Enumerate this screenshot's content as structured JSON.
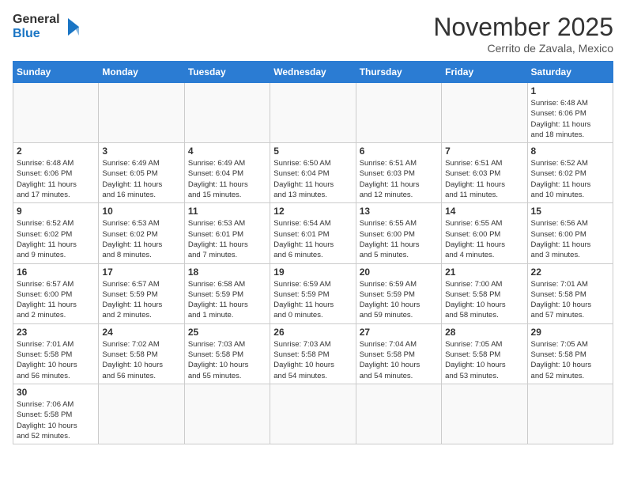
{
  "logo": {
    "line1": "General",
    "line2": "Blue"
  },
  "title": "November 2025",
  "location": "Cerrito de Zavala, Mexico",
  "days_of_week": [
    "Sunday",
    "Monday",
    "Tuesday",
    "Wednesday",
    "Thursday",
    "Friday",
    "Saturday"
  ],
  "weeks": [
    [
      {
        "day": "",
        "info": ""
      },
      {
        "day": "",
        "info": ""
      },
      {
        "day": "",
        "info": ""
      },
      {
        "day": "",
        "info": ""
      },
      {
        "day": "",
        "info": ""
      },
      {
        "day": "",
        "info": ""
      },
      {
        "day": "1",
        "info": "Sunrise: 6:48 AM\nSunset: 6:06 PM\nDaylight: 11 hours\nand 18 minutes."
      }
    ],
    [
      {
        "day": "2",
        "info": "Sunrise: 6:48 AM\nSunset: 6:06 PM\nDaylight: 11 hours\nand 17 minutes."
      },
      {
        "day": "3",
        "info": "Sunrise: 6:49 AM\nSunset: 6:05 PM\nDaylight: 11 hours\nand 16 minutes."
      },
      {
        "day": "4",
        "info": "Sunrise: 6:49 AM\nSunset: 6:04 PM\nDaylight: 11 hours\nand 15 minutes."
      },
      {
        "day": "5",
        "info": "Sunrise: 6:50 AM\nSunset: 6:04 PM\nDaylight: 11 hours\nand 13 minutes."
      },
      {
        "day": "6",
        "info": "Sunrise: 6:51 AM\nSunset: 6:03 PM\nDaylight: 11 hours\nand 12 minutes."
      },
      {
        "day": "7",
        "info": "Sunrise: 6:51 AM\nSunset: 6:03 PM\nDaylight: 11 hours\nand 11 minutes."
      },
      {
        "day": "8",
        "info": "Sunrise: 6:52 AM\nSunset: 6:02 PM\nDaylight: 11 hours\nand 10 minutes."
      }
    ],
    [
      {
        "day": "9",
        "info": "Sunrise: 6:52 AM\nSunset: 6:02 PM\nDaylight: 11 hours\nand 9 minutes."
      },
      {
        "day": "10",
        "info": "Sunrise: 6:53 AM\nSunset: 6:02 PM\nDaylight: 11 hours\nand 8 minutes."
      },
      {
        "day": "11",
        "info": "Sunrise: 6:53 AM\nSunset: 6:01 PM\nDaylight: 11 hours\nand 7 minutes."
      },
      {
        "day": "12",
        "info": "Sunrise: 6:54 AM\nSunset: 6:01 PM\nDaylight: 11 hours\nand 6 minutes."
      },
      {
        "day": "13",
        "info": "Sunrise: 6:55 AM\nSunset: 6:00 PM\nDaylight: 11 hours\nand 5 minutes."
      },
      {
        "day": "14",
        "info": "Sunrise: 6:55 AM\nSunset: 6:00 PM\nDaylight: 11 hours\nand 4 minutes."
      },
      {
        "day": "15",
        "info": "Sunrise: 6:56 AM\nSunset: 6:00 PM\nDaylight: 11 hours\nand 3 minutes."
      }
    ],
    [
      {
        "day": "16",
        "info": "Sunrise: 6:57 AM\nSunset: 6:00 PM\nDaylight: 11 hours\nand 2 minutes."
      },
      {
        "day": "17",
        "info": "Sunrise: 6:57 AM\nSunset: 5:59 PM\nDaylight: 11 hours\nand 2 minutes."
      },
      {
        "day": "18",
        "info": "Sunrise: 6:58 AM\nSunset: 5:59 PM\nDaylight: 11 hours\nand 1 minute."
      },
      {
        "day": "19",
        "info": "Sunrise: 6:59 AM\nSunset: 5:59 PM\nDaylight: 11 hours\nand 0 minutes."
      },
      {
        "day": "20",
        "info": "Sunrise: 6:59 AM\nSunset: 5:59 PM\nDaylight: 10 hours\nand 59 minutes."
      },
      {
        "day": "21",
        "info": "Sunrise: 7:00 AM\nSunset: 5:58 PM\nDaylight: 10 hours\nand 58 minutes."
      },
      {
        "day": "22",
        "info": "Sunrise: 7:01 AM\nSunset: 5:58 PM\nDaylight: 10 hours\nand 57 minutes."
      }
    ],
    [
      {
        "day": "23",
        "info": "Sunrise: 7:01 AM\nSunset: 5:58 PM\nDaylight: 10 hours\nand 56 minutes."
      },
      {
        "day": "24",
        "info": "Sunrise: 7:02 AM\nSunset: 5:58 PM\nDaylight: 10 hours\nand 56 minutes."
      },
      {
        "day": "25",
        "info": "Sunrise: 7:03 AM\nSunset: 5:58 PM\nDaylight: 10 hours\nand 55 minutes."
      },
      {
        "day": "26",
        "info": "Sunrise: 7:03 AM\nSunset: 5:58 PM\nDaylight: 10 hours\nand 54 minutes."
      },
      {
        "day": "27",
        "info": "Sunrise: 7:04 AM\nSunset: 5:58 PM\nDaylight: 10 hours\nand 54 minutes."
      },
      {
        "day": "28",
        "info": "Sunrise: 7:05 AM\nSunset: 5:58 PM\nDaylight: 10 hours\nand 53 minutes."
      },
      {
        "day": "29",
        "info": "Sunrise: 7:05 AM\nSunset: 5:58 PM\nDaylight: 10 hours\nand 52 minutes."
      }
    ],
    [
      {
        "day": "30",
        "info": "Sunrise: 7:06 AM\nSunset: 5:58 PM\nDaylight: 10 hours\nand 52 minutes."
      },
      {
        "day": "",
        "info": ""
      },
      {
        "day": "",
        "info": ""
      },
      {
        "day": "",
        "info": ""
      },
      {
        "day": "",
        "info": ""
      },
      {
        "day": "",
        "info": ""
      },
      {
        "day": "",
        "info": ""
      }
    ]
  ]
}
